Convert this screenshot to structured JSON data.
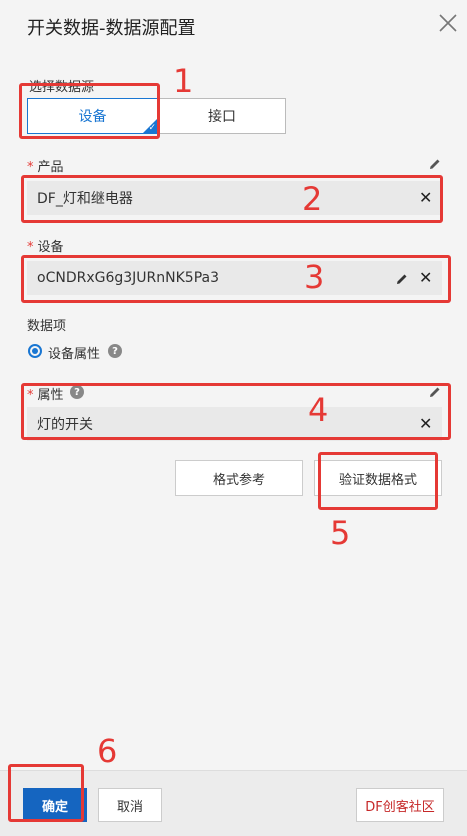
{
  "dialog": {
    "title": "开关数据-数据源配置"
  },
  "source": {
    "label": "选择数据源",
    "options": [
      "设备",
      "接口"
    ],
    "selected": "设备"
  },
  "product": {
    "label": "产品",
    "value": "DF_灯和继电器"
  },
  "device": {
    "label": "设备",
    "value": "oCNDRxG6g3JURnNK5Pa3"
  },
  "data_item": {
    "label": "数据项",
    "option": "设备属性"
  },
  "attribute": {
    "label": "属性",
    "value": "灯的开关"
  },
  "buttons": {
    "format_ref": "格式参考",
    "verify": "验证数据格式",
    "confirm": "确定",
    "cancel": "取消"
  },
  "annotations": [
    "1",
    "2",
    "3",
    "4",
    "5",
    "6"
  ],
  "watermark": "DF创客社区",
  "colors": {
    "accent": "#1976d2",
    "annotation": "#e53935",
    "confirm": "#1565c0"
  }
}
